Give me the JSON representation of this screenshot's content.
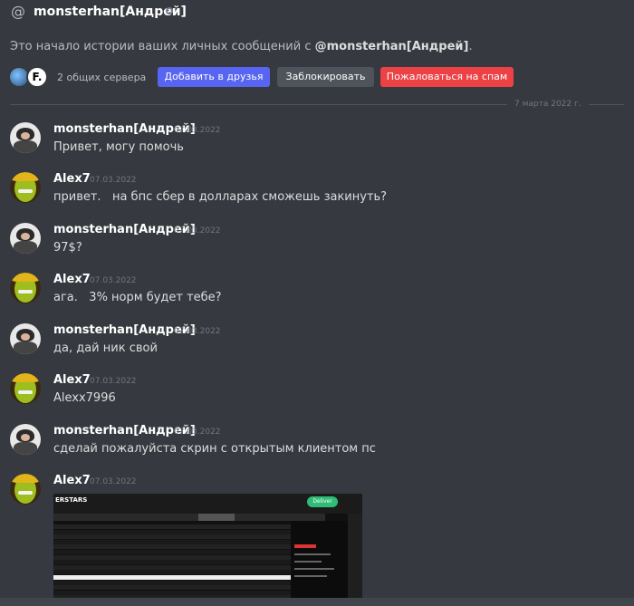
{
  "header": {
    "title": "monsterhan[Андрей]"
  },
  "intro": {
    "prefix": "Это начало истории ваших личных сообщений с ",
    "user": "@monsterhan[Андрей]",
    "suffix": "."
  },
  "profile_actions": {
    "mutual_servers": "2 общих сервера",
    "server2_letter": "F.",
    "add_friend": "Добавить в друзья",
    "block": "Заблокировать",
    "report_spam": "Пожаловаться на спам"
  },
  "date_divider": "7 марта 2022 г.",
  "messages": [
    {
      "author": "monsterhan[Андрей]",
      "time": "07.03.2022",
      "text": "Привет, могу помочь"
    },
    {
      "author": "Alex7",
      "time": "07.03.2022",
      "text": "привет.   на бпс сбер в долларах сможешь закинуть?"
    },
    {
      "author": "monsterhan[Андрей]",
      "time": "07.03.2022",
      "text": "97$?"
    },
    {
      "author": "Alex7",
      "time": "07.03.2022",
      "text": "ага.   3% норм будет тебе?"
    },
    {
      "author": "monsterhan[Андрей]",
      "time": "07.03.2022",
      "text": "да, дай ник свой"
    },
    {
      "author": "Alex7",
      "time": "07.03.2022",
      "text": "Alexx7996"
    },
    {
      "author": "monsterhan[Андрей]",
      "time": "07.03.2022",
      "text": "сделай пожалуйста скрин с открытым клиентом пс"
    },
    {
      "author": "Alex7",
      "time": "07.03.2022",
      "text": ""
    }
  ],
  "attachment": {
    "logo": "ERSTARS",
    "button": "Deliver"
  },
  "colors": {
    "background": "#36393f",
    "blurple": "#5865f2",
    "danger": "#ed4245",
    "secondary": "#4f545c"
  },
  "icons": {
    "header": "at-sign-icon",
    "status": "offline-status-icon"
  }
}
